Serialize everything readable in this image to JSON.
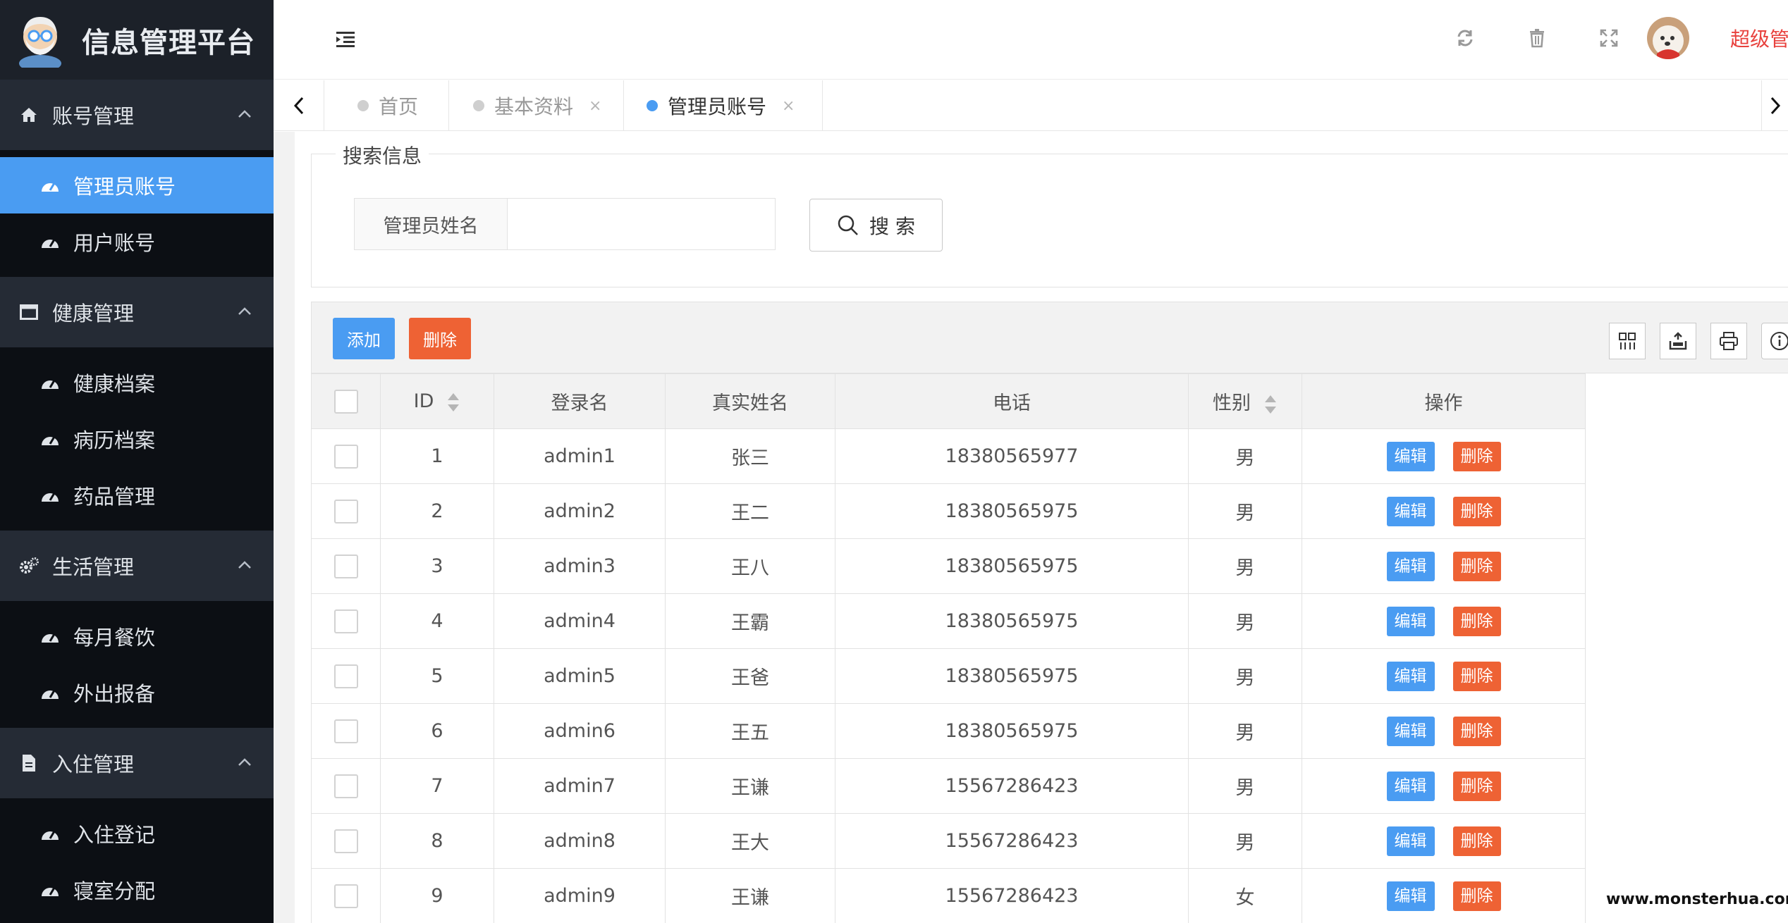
{
  "app": {
    "title": "信息管理平台"
  },
  "sidebar": {
    "groups": [
      {
        "label": "账号管理",
        "icon": "home-icon",
        "items": [
          {
            "label": "管理员账号",
            "active": true
          },
          {
            "label": "用户账号"
          }
        ]
      },
      {
        "label": "健康管理",
        "icon": "window-icon",
        "items": [
          {
            "label": "健康档案"
          },
          {
            "label": "病历档案"
          },
          {
            "label": "药品管理"
          }
        ]
      },
      {
        "label": "生活管理",
        "icon": "gears-icon",
        "items": [
          {
            "label": "每月餐饮"
          },
          {
            "label": "外出报备"
          }
        ]
      },
      {
        "label": "入住管理",
        "icon": "file-icon",
        "items": [
          {
            "label": "入住登记"
          },
          {
            "label": "寝室分配"
          }
        ]
      }
    ]
  },
  "header": {
    "user_name": "超级管",
    "icons": [
      "menu-indent-icon",
      "refresh-icon",
      "trash-icon",
      "fullscreen-icon"
    ]
  },
  "tabs": [
    {
      "label": "首页",
      "closable": false
    },
    {
      "label": "基本资料",
      "closable": true,
      "close": "×"
    },
    {
      "label": "管理员账号",
      "closable": true,
      "close": "×",
      "active": true
    }
  ],
  "search": {
    "legend": "搜索信息",
    "field_label": "管理员姓名",
    "field_value": "",
    "button_label": "搜 索"
  },
  "toolbar": {
    "add_label": "添加",
    "delete_label": "删除"
  },
  "table": {
    "headers": {
      "id": "ID",
      "login": "登录名",
      "name": "真实姓名",
      "phone": "电话",
      "gender": "性别",
      "actions": "操作"
    },
    "edit_label": "编辑",
    "delete_label": "删除",
    "rows": [
      {
        "id": "1",
        "login": "admin1",
        "name": "张三",
        "phone": "18380565977",
        "gender": "男"
      },
      {
        "id": "2",
        "login": "admin2",
        "name": "王二",
        "phone": "18380565975",
        "gender": "男"
      },
      {
        "id": "3",
        "login": "admin3",
        "name": "王八",
        "phone": "18380565975",
        "gender": "男"
      },
      {
        "id": "4",
        "login": "admin4",
        "name": "王霸",
        "phone": "18380565975",
        "gender": "男"
      },
      {
        "id": "5",
        "login": "admin5",
        "name": "王爸",
        "phone": "18380565975",
        "gender": "男"
      },
      {
        "id": "6",
        "login": "admin6",
        "name": "王五",
        "phone": "18380565975",
        "gender": "男"
      },
      {
        "id": "7",
        "login": "admin7",
        "name": "王谦",
        "phone": "15567286423",
        "gender": "男"
      },
      {
        "id": "8",
        "login": "admin8",
        "name": "王大",
        "phone": "15567286423",
        "gender": "男"
      },
      {
        "id": "9",
        "login": "admin9",
        "name": "王谦",
        "phone": "15567286423",
        "gender": "女"
      }
    ]
  },
  "watermark": "www.monsterhua.com",
  "colors": {
    "accent": "#4a9cf2",
    "danger": "#ee6234",
    "sidebar_bg": "#0c0f14",
    "sidebar_group_bg": "#252b35",
    "user_name": "#e8413d"
  }
}
